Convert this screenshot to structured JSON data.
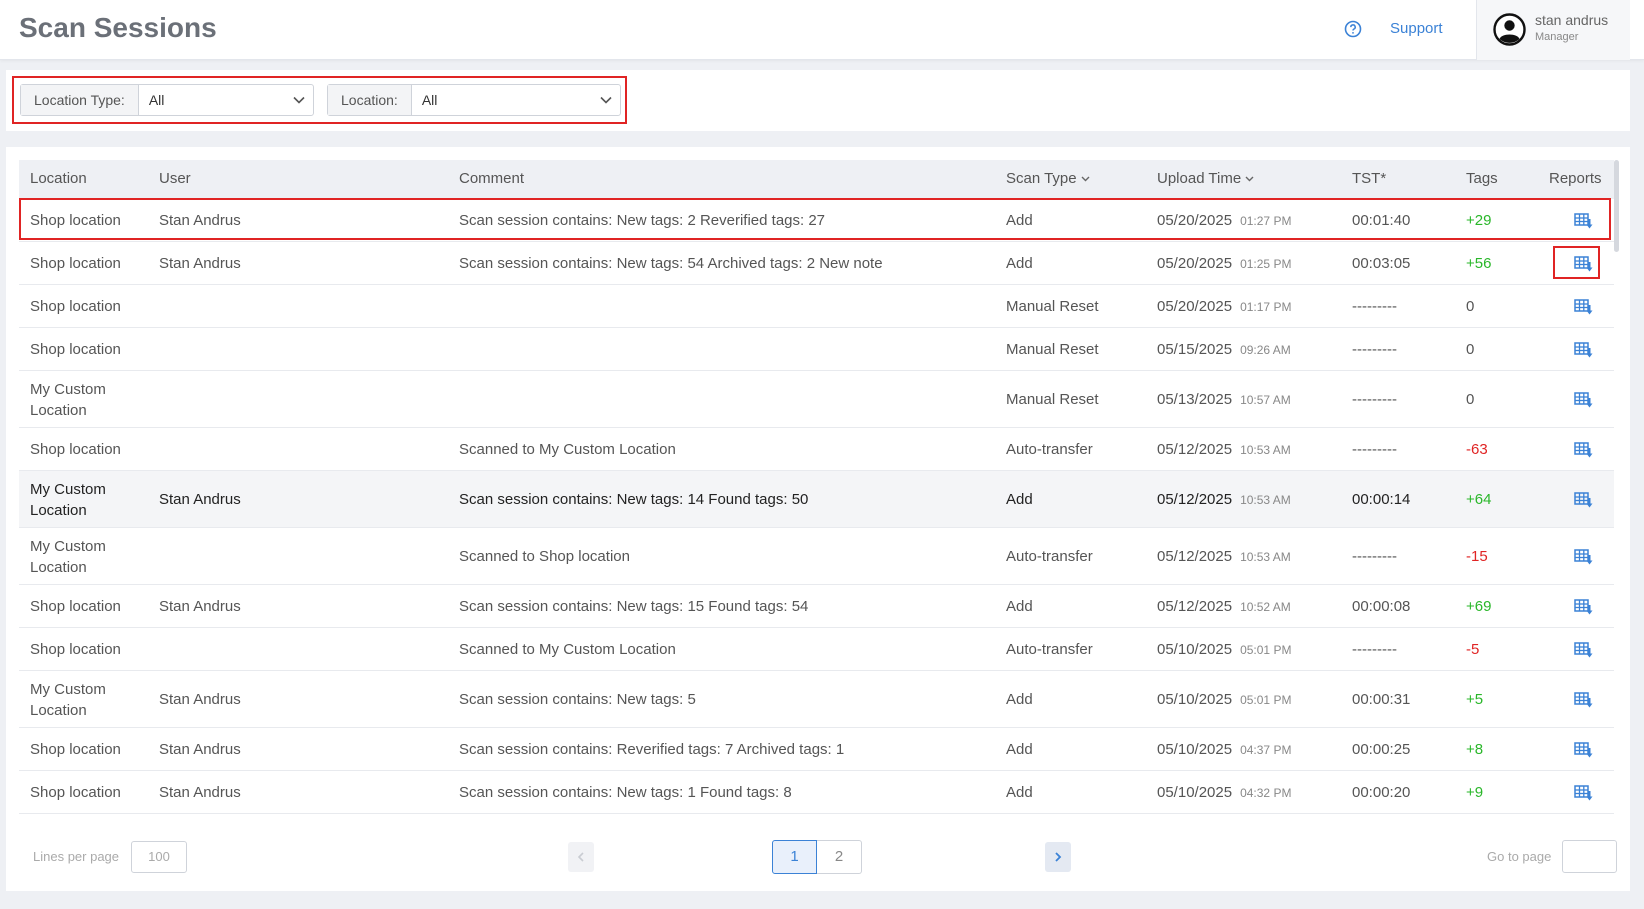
{
  "header": {
    "title": "Scan Sessions",
    "support_label": "Support",
    "user_name": "stan andrus",
    "user_role": "Manager"
  },
  "filters": {
    "location_type_label": "Location Type:",
    "location_type_value": "All",
    "location_label": "Location:",
    "location_value": "All"
  },
  "table": {
    "columns": [
      "Location",
      "User",
      "Comment",
      "Scan Type",
      "Upload Time",
      "TST*",
      "Tags",
      "Reports"
    ],
    "rows": [
      {
        "location": "Shop location",
        "user": "Stan Andrus",
        "comment": "Scan session contains: New tags: 2 Reverified tags: 27",
        "scan_type": "Add",
        "date": "05/20/2025",
        "time": "01:27 PM",
        "tst": "00:01:40",
        "tags": "+29"
      },
      {
        "location": "Shop location",
        "user": "Stan Andrus",
        "comment": "Scan session contains: New tags: 54 Archived tags: 2 New note",
        "scan_type": "Add",
        "date": "05/20/2025",
        "time": "01:25 PM",
        "tst": "00:03:05",
        "tags": "+56"
      },
      {
        "location": "Shop location",
        "user": "",
        "comment": "",
        "scan_type": "Manual Reset",
        "date": "05/20/2025",
        "time": "01:17 PM",
        "tst": "---------",
        "tags": "0"
      },
      {
        "location": "Shop location",
        "user": "",
        "comment": "",
        "scan_type": "Manual Reset",
        "date": "05/15/2025",
        "time": "09:26 AM",
        "tst": "---------",
        "tags": "0"
      },
      {
        "location": "My Custom Location",
        "user": "",
        "comment": "",
        "scan_type": "Manual Reset",
        "date": "05/13/2025",
        "time": "10:57 AM",
        "tst": "---------",
        "tags": "0"
      },
      {
        "location": "Shop location",
        "user": "",
        "comment": "Scanned to My Custom Location",
        "scan_type": "Auto-transfer",
        "date": "05/12/2025",
        "time": "10:53 AM",
        "tst": "---------",
        "tags": "-63"
      },
      {
        "location": "My Custom Location",
        "user": "Stan Andrus",
        "comment": "Scan session contains: New tags: 14 Found tags: 50",
        "scan_type": "Add",
        "date": "05/12/2025",
        "time": "10:53 AM",
        "tst": "00:00:14",
        "tags": "+64"
      },
      {
        "location": "My Custom Location",
        "user": "",
        "comment": "Scanned to Shop location",
        "scan_type": "Auto-transfer",
        "date": "05/12/2025",
        "time": "10:53 AM",
        "tst": "---------",
        "tags": "-15"
      },
      {
        "location": "Shop location",
        "user": "Stan Andrus",
        "comment": "Scan session contains: New tags: 15 Found tags: 54",
        "scan_type": "Add",
        "date": "05/12/2025",
        "time": "10:52 AM",
        "tst": "00:00:08",
        "tags": "+69"
      },
      {
        "location": "Shop location",
        "user": "",
        "comment": "Scanned to My Custom Location",
        "scan_type": "Auto-transfer",
        "date": "05/10/2025",
        "time": "05:01 PM",
        "tst": "---------",
        "tags": "-5"
      },
      {
        "location": "My Custom Location",
        "user": "Stan Andrus",
        "comment": "Scan session contains: New tags: 5",
        "scan_type": "Add",
        "date": "05/10/2025",
        "time": "05:01 PM",
        "tst": "00:00:31",
        "tags": "+5"
      },
      {
        "location": "Shop location",
        "user": "Stan Andrus",
        "comment": "Scan session contains: Reverified tags: 7 Archived tags: 1",
        "scan_type": "Add",
        "date": "05/10/2025",
        "time": "04:37 PM",
        "tst": "00:00:25",
        "tags": "+8"
      },
      {
        "location": "Shop location",
        "user": "Stan Andrus",
        "comment": "Scan session contains: New tags: 1 Found tags: 8",
        "scan_type": "Add",
        "date": "05/10/2025",
        "time": "04:32 PM",
        "tst": "00:00:20",
        "tags": "+9"
      }
    ]
  },
  "pagination": {
    "lines_label": "Lines per page",
    "lines_value": "100",
    "pages": [
      "1",
      "2"
    ],
    "goto_label": "Go to page"
  },
  "colors": {
    "accent": "#3b82d6",
    "positive": "#2ab72a",
    "negative": "#e02424",
    "highlight": "#e02424"
  }
}
